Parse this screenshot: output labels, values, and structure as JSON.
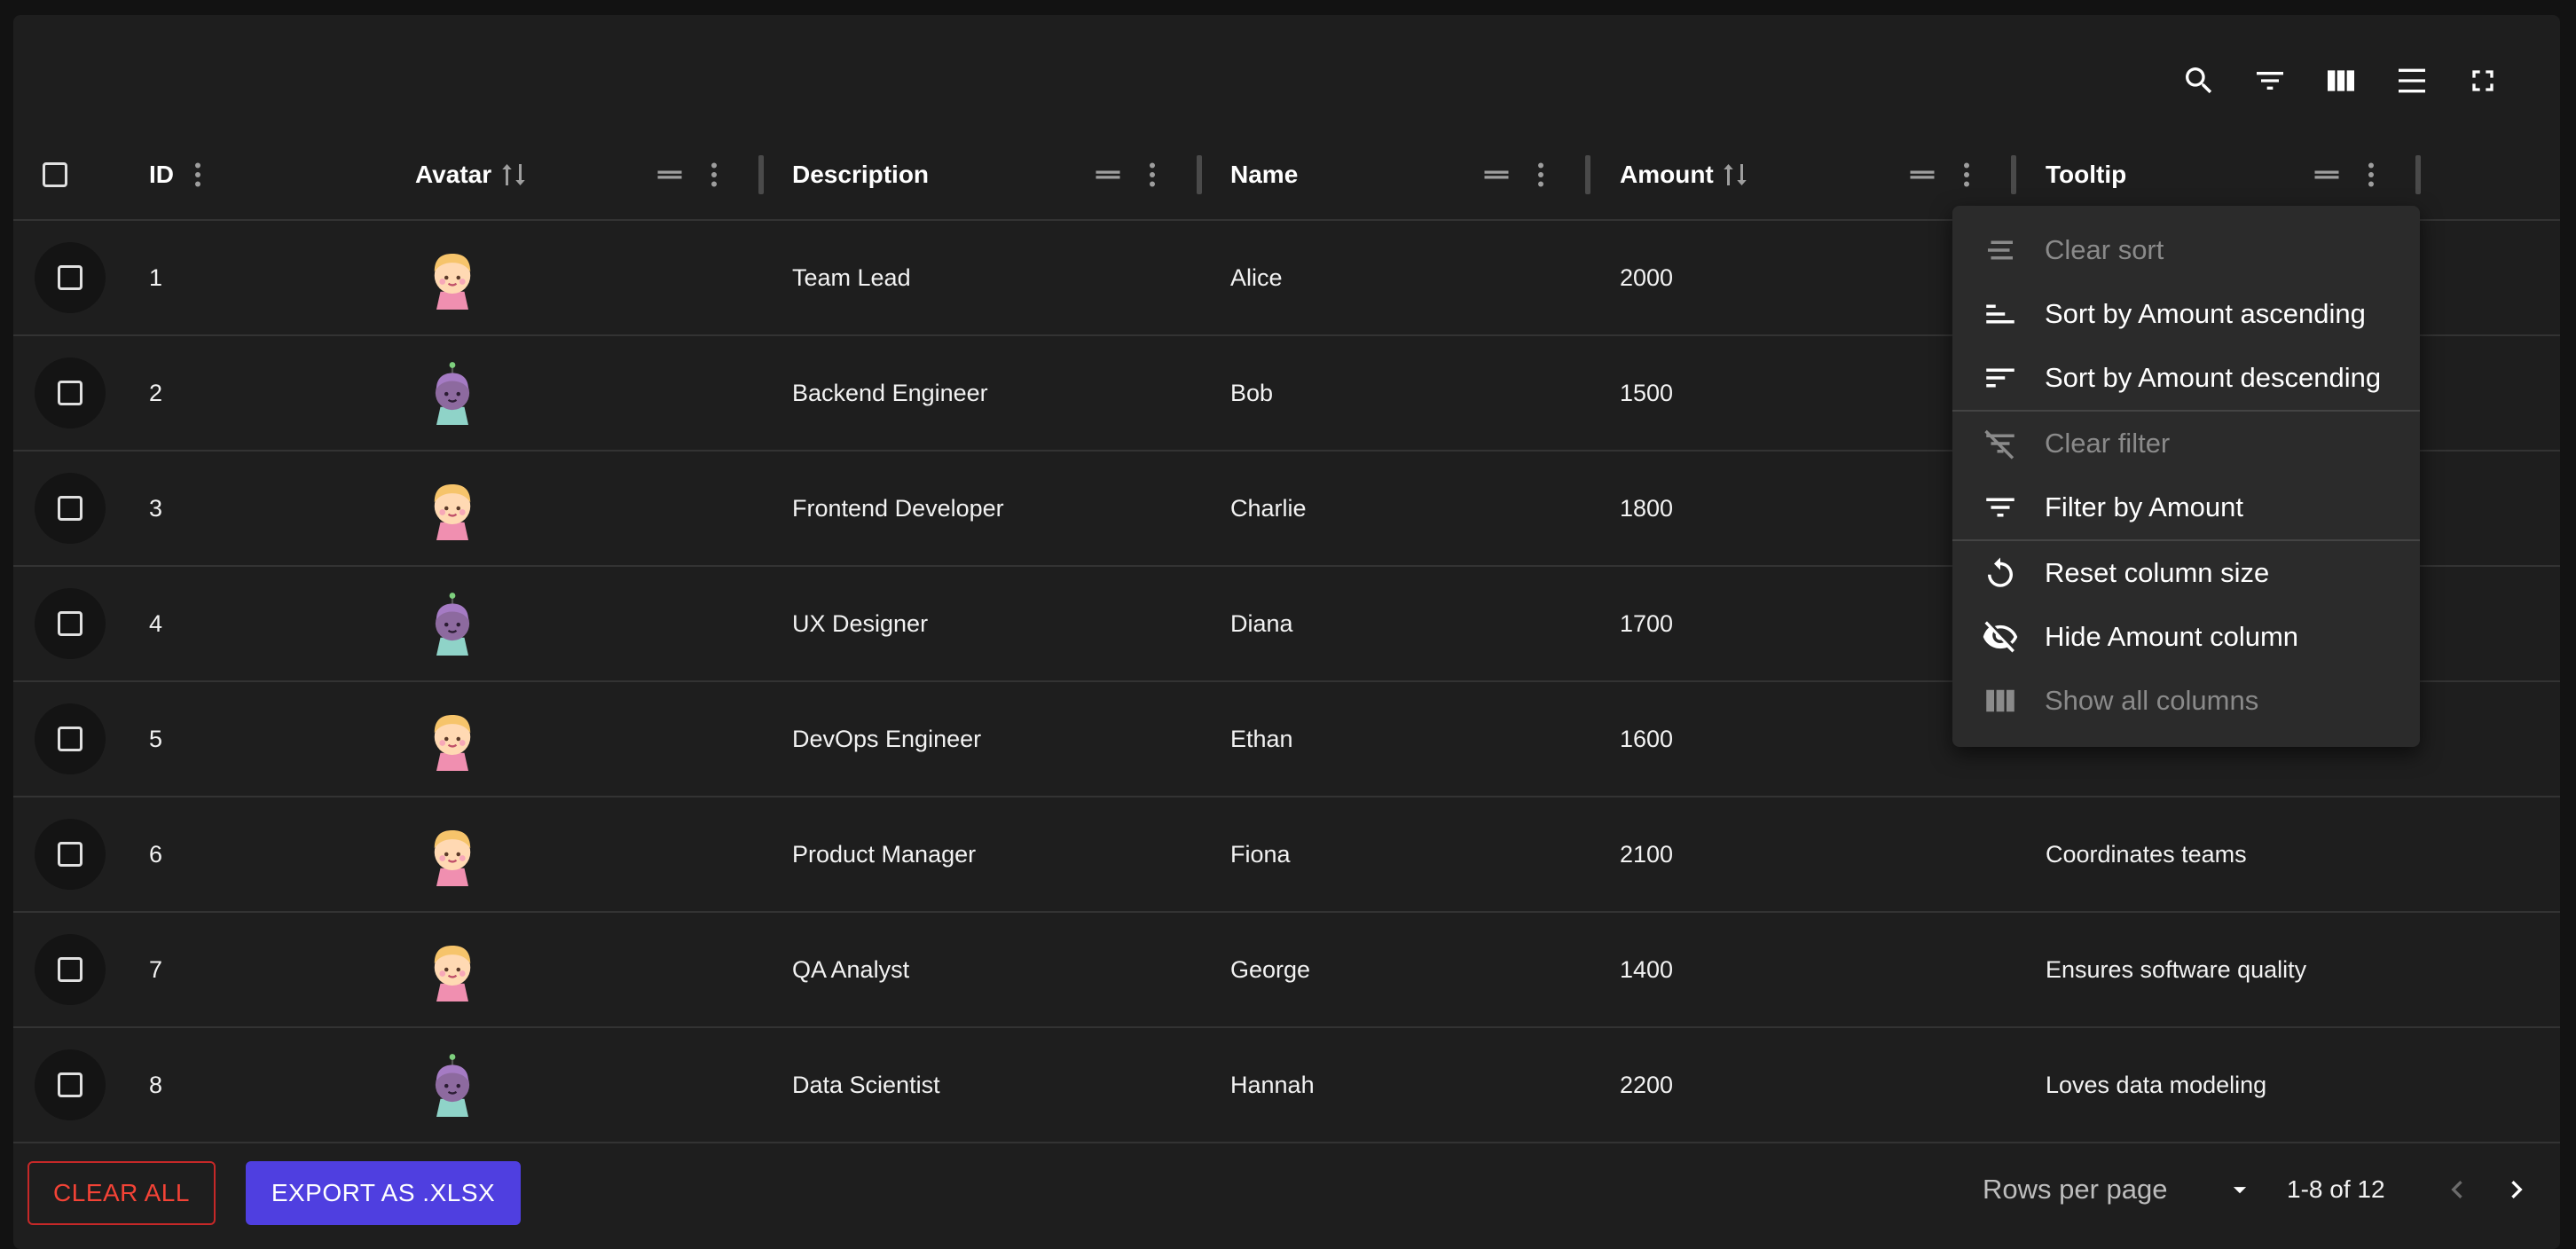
{
  "columns": {
    "id": "ID",
    "avatar": "Avatar",
    "description": "Description",
    "name": "Name",
    "amount": "Amount",
    "tooltip": "Tooltip"
  },
  "rows": [
    {
      "id": "1",
      "avatar": "avatar-girl",
      "description": "Team Lead",
      "name": "Alice",
      "amount": "2000",
      "tooltip": ""
    },
    {
      "id": "2",
      "avatar": "avatar-alien",
      "description": "Backend Engineer",
      "name": "Bob",
      "amount": "1500",
      "tooltip": ""
    },
    {
      "id": "3",
      "avatar": "avatar-girl",
      "description": "Frontend Developer",
      "name": "Charlie",
      "amount": "1800",
      "tooltip": ""
    },
    {
      "id": "4",
      "avatar": "avatar-alien",
      "description": "UX Designer",
      "name": "Diana",
      "amount": "1700",
      "tooltip": ""
    },
    {
      "id": "5",
      "avatar": "avatar-girl",
      "description": "DevOps Engineer",
      "name": "Ethan",
      "amount": "1600",
      "tooltip": ""
    },
    {
      "id": "6",
      "avatar": "avatar-girl",
      "description": "Product Manager",
      "name": "Fiona",
      "amount": "2100",
      "tooltip": "Coordinates teams"
    },
    {
      "id": "7",
      "avatar": "avatar-girl",
      "description": "QA Analyst",
      "name": "George",
      "amount": "1400",
      "tooltip": "Ensures software quality"
    },
    {
      "id": "8",
      "avatar": "avatar-alien",
      "description": "Data Scientist",
      "name": "Hannah",
      "amount": "2200",
      "tooltip": "Loves data modeling"
    }
  ],
  "column_menu": {
    "clear_sort": "Clear sort",
    "sort_asc": "Sort by Amount ascending",
    "sort_desc": "Sort by Amount descending",
    "clear_filter": "Clear filter",
    "filter": "Filter by Amount",
    "reset_size": "Reset column size",
    "hide_column": "Hide Amount column",
    "show_all": "Show all columns"
  },
  "footer": {
    "clear_all": "CLEAR ALL",
    "export": "EXPORT AS .XLSX",
    "rows_per_page": "Rows per page",
    "page_info": "1-8 of 12"
  },
  "colors": {
    "background": "#1e1e1e",
    "menu_background": "#2b2b2b",
    "clear_all": "#f44336",
    "export_button": "#4f3fe0"
  },
  "icons": [
    "search-icon",
    "filter-icon",
    "columns-icon",
    "density-icon",
    "fullscreen-icon",
    "sort-icon",
    "drag-handle-icon",
    "more-vert-icon"
  ]
}
